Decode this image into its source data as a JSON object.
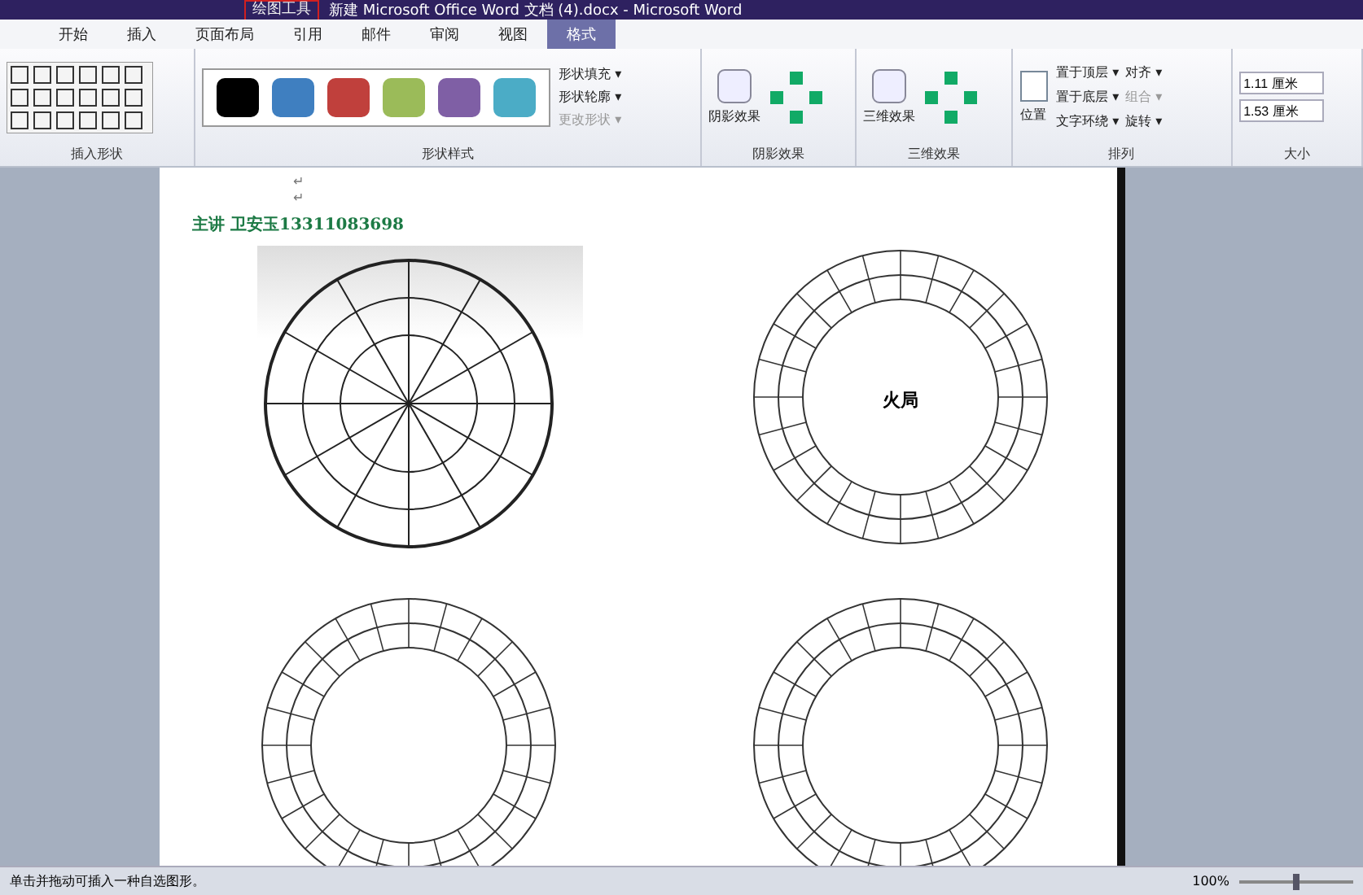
{
  "title_bar": {
    "contextual_tab": "绘图工具",
    "title": "新建 Microsoft Office Word 文档 (4).docx - Microsoft Word"
  },
  "tabs": [
    {
      "label": "开始",
      "selected": false
    },
    {
      "label": "插入",
      "selected": false
    },
    {
      "label": "页面布局",
      "selected": false
    },
    {
      "label": "引用",
      "selected": false
    },
    {
      "label": "邮件",
      "selected": false
    },
    {
      "label": "审阅",
      "selected": false
    },
    {
      "label": "视图",
      "selected": false
    },
    {
      "label": "格式",
      "selected": true
    }
  ],
  "ribbon": {
    "groups": [
      {
        "kind": "shapes",
        "label": "插入形状"
      },
      {
        "kind": "styles",
        "label": "形状样式",
        "swatches": [
          {
            "color": "#000000"
          },
          {
            "color": "#3f7fc0"
          },
          {
            "color": "#c0403c"
          },
          {
            "color": "#9bbb59"
          },
          {
            "color": "#7f5fa5"
          },
          {
            "color": "#4bacc6"
          }
        ],
        "commands": [
          {
            "label": "形状填充 ▾",
            "disabled": false
          },
          {
            "label": "形状轮廓 ▾",
            "disabled": false
          },
          {
            "label": "更改形状 ▾",
            "disabled": true
          }
        ]
      },
      {
        "kind": "shadow",
        "label": "阴影效果",
        "button": "阴影效果"
      },
      {
        "kind": "threed",
        "label": "三维效果",
        "button": "三维效果"
      },
      {
        "kind": "arrange",
        "label": "排列",
        "button": "位置",
        "commands": [
          {
            "label": "置于顶层 ▾",
            "disabled": false
          },
          {
            "label": "对齐 ▾",
            "disabled": false
          },
          {
            "label": "置于底层 ▾",
            "disabled": false
          },
          {
            "label": "组合 ▾",
            "disabled": true
          },
          {
            "label": "文字环绕 ▾",
            "disabled": false
          },
          {
            "label": "旋转 ▾",
            "disabled": false
          }
        ]
      },
      {
        "kind": "size",
        "label": "大小",
        "fields": [
          {
            "value": "1.11 厘米"
          },
          {
            "value": "1.53 厘米"
          }
        ]
      }
    ]
  },
  "document": {
    "marks": [
      "↵",
      "↵"
    ],
    "heading": "主讲  卫安玉13311083698",
    "center_label": "火局"
  },
  "status_bar": {
    "message": "单击并拖动可插入一种自选图形。",
    "zoom": "100%",
    "level": 0.5
  }
}
